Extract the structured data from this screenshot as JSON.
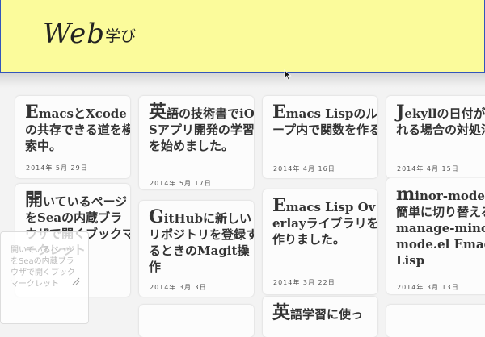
{
  "header": {
    "logo_main": "Web",
    "logo_sub": "学び"
  },
  "posts": [
    {
      "cap": "E",
      "rest": "macsとXcodeの共存できる道を模索中。",
      "date": "2014年 5月 29日"
    },
    {
      "cap": "英",
      "rest": "語の技術書でiOSアプリ開発の学習を始めました。",
      "date": "2014年 5月 17日"
    },
    {
      "cap": "E",
      "rest": "macs Lispのループ内で関数を作る",
      "date": "2014年 4月 16日"
    },
    {
      "cap": "J",
      "rest": "ekyllの日付がずれる場合の対処法",
      "date": "2014年 4月 15日"
    },
    {
      "cap": "開",
      "rest": "いているページをSeaの内蔵ブラウザで開くブックマークレット",
      "date": ""
    },
    {
      "cap": "G",
      "rest": "itHubに新しいリポジトリを登録するときのMagit操作",
      "date": "2014年 3月 3日"
    },
    {
      "cap": "E",
      "rest": "macs Lisp Overlayライブラリを作りました。",
      "date": "2014年 3月 22日"
    },
    {
      "cap": "m",
      "rest": "inor-modeを簡単に切り替える manage-minor-mode.el Emacs Lisp",
      "date": "2014年 3月 13日"
    },
    {
      "cap": "英",
      "rest": "語学習に使っ",
      "date": ""
    }
  ],
  "overlay": {
    "text": "開いているページをSeaの内蔵ブラウザで開くブックマークレット"
  }
}
